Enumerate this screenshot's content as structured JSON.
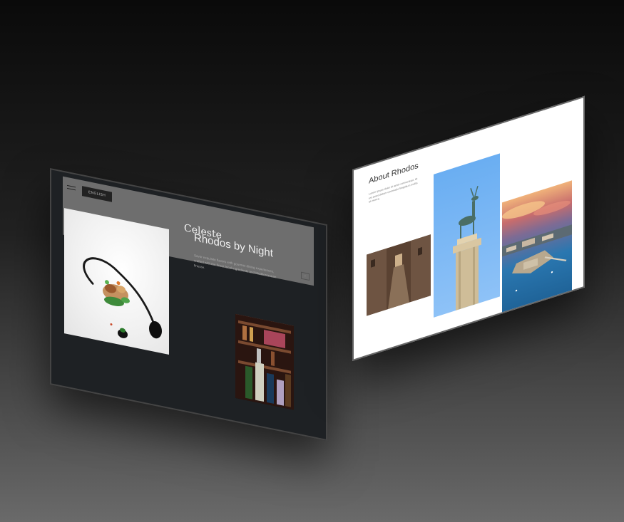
{
  "left_page": {
    "menu_icon": "hamburger-menu-icon",
    "language_label": "ENGLISH",
    "logo_text": "Celeste",
    "corner_icon": "arrow-icon",
    "title": "Rhodos by Night",
    "description": "Savor exquisite flavors with gourmet dining experiences, crafted with the finest local ingredients and Mediterranean finesse.",
    "images": [
      "gourmet-dish-image",
      "bar-bottles-image"
    ]
  },
  "right_page": {
    "title": "About Rhodos",
    "description": "Lorem ipsum dolor sit amet consectetur. Ut est amet dictum commodo fringilla in mollis id viverra.",
    "images": [
      "old-town-street-image",
      "deer-statue-image",
      "harbor-aerial-image"
    ]
  },
  "colors": {
    "background_top": "#0a0a0a",
    "background_bottom": "#6a6a6a",
    "left_page_bg": "#1e2124",
    "left_header_bg": "#6e6e6e",
    "right_page_bg": "#ffffff",
    "sky_blue": "#6aaef2"
  }
}
